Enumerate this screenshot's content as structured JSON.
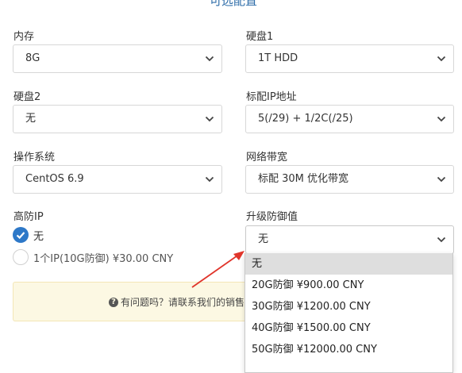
{
  "section": {
    "title": "可选配置"
  },
  "fields": {
    "memory": {
      "label": "内存",
      "value": "8G"
    },
    "disk1": {
      "label": "硬盘1",
      "value": "1T HDD"
    },
    "disk2": {
      "label": "硬盘2",
      "value": "无"
    },
    "ip": {
      "label": "标配IP地址",
      "value": "5(/29) + 1/2C(/25)"
    },
    "os": {
      "label": "操作系统",
      "value": "CentOS 6.9"
    },
    "bandwidth": {
      "label": "网络带宽",
      "value": "标配 30M 优化带宽"
    },
    "ddos_ip": {
      "label": "高防IP",
      "options": [
        {
          "label": "无",
          "checked": true
        },
        {
          "label": "1个IP(10G防御) ¥30.00 CNY",
          "checked": false
        }
      ]
    },
    "protection": {
      "label": "升级防御值",
      "value": "无",
      "options": [
        "无",
        "20G防御 ¥900.00 CNY",
        "30G防御 ¥1200.00 CNY",
        "40G防御 ¥1500.00 CNY",
        "50G防御 ¥12000.00 CNY"
      ],
      "highlighted_index": 0
    }
  },
  "notice": {
    "text": "有问题吗？请联系我们的销售"
  },
  "icons": {
    "chevron": "chevron-down-icon",
    "check": "check-icon",
    "question": "question-circle-icon"
  },
  "colors": {
    "accent": "#2d78c8",
    "notice_bg": "#fcf8e3",
    "annotation_arrow": "#e0352b"
  }
}
